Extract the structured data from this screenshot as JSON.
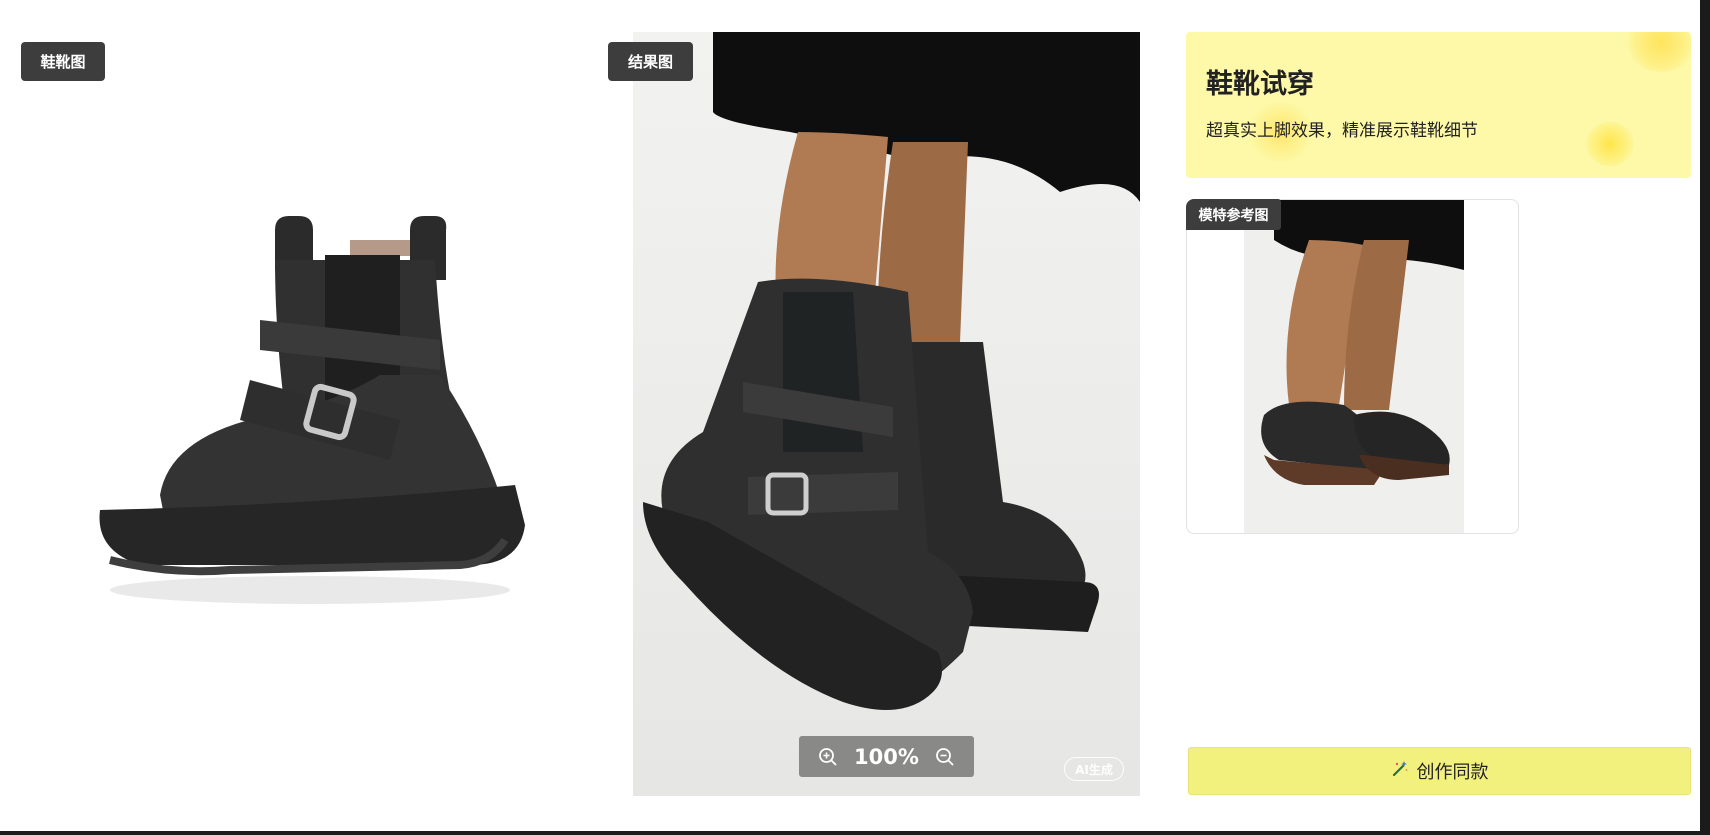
{
  "shoe_panel": {
    "tag": "鞋靴图"
  },
  "result_panel": {
    "tag": "结果图",
    "zoom_level": "100%",
    "ai_badge": "AI生成"
  },
  "info_card": {
    "title": "鞋靴试穿",
    "subtitle": "超真实上脚效果，精准展示鞋靴细节"
  },
  "model_card": {
    "tag": "模特参考图"
  },
  "create_button": {
    "label": "创作同款",
    "icon": "magic-wand-icon"
  },
  "zoom_icons": {
    "in": "zoom-in-icon",
    "out": "zoom-out-icon"
  },
  "colors": {
    "accent_yellow": "#f3f17e",
    "card_yellow": "#fdf9a8",
    "tag_bg": "#3d3d3d"
  }
}
